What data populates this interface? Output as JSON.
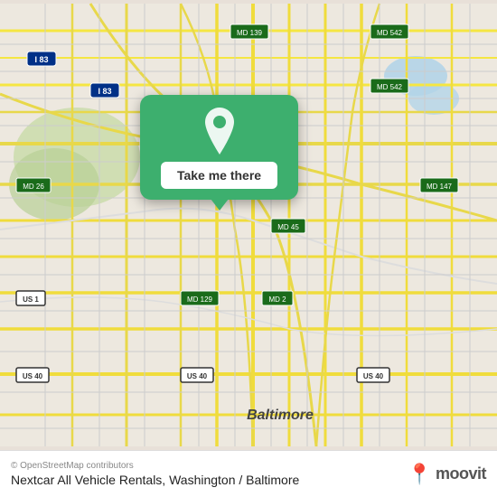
{
  "map": {
    "bg_color": "#e8e0d8",
    "attribution": "© OpenStreetMap contributors",
    "alt": "Map of Baltimore area"
  },
  "popup": {
    "cta_label": "Take me there",
    "bg_color": "#3daf6e",
    "pin_icon": "location-pin"
  },
  "bottom_bar": {
    "location_name": "Nextcar All Vehicle Rentals, Washington / Baltimore",
    "attribution": "© OpenStreetMap contributors",
    "moovit_label": "moovit",
    "moovit_pin": "📍"
  }
}
